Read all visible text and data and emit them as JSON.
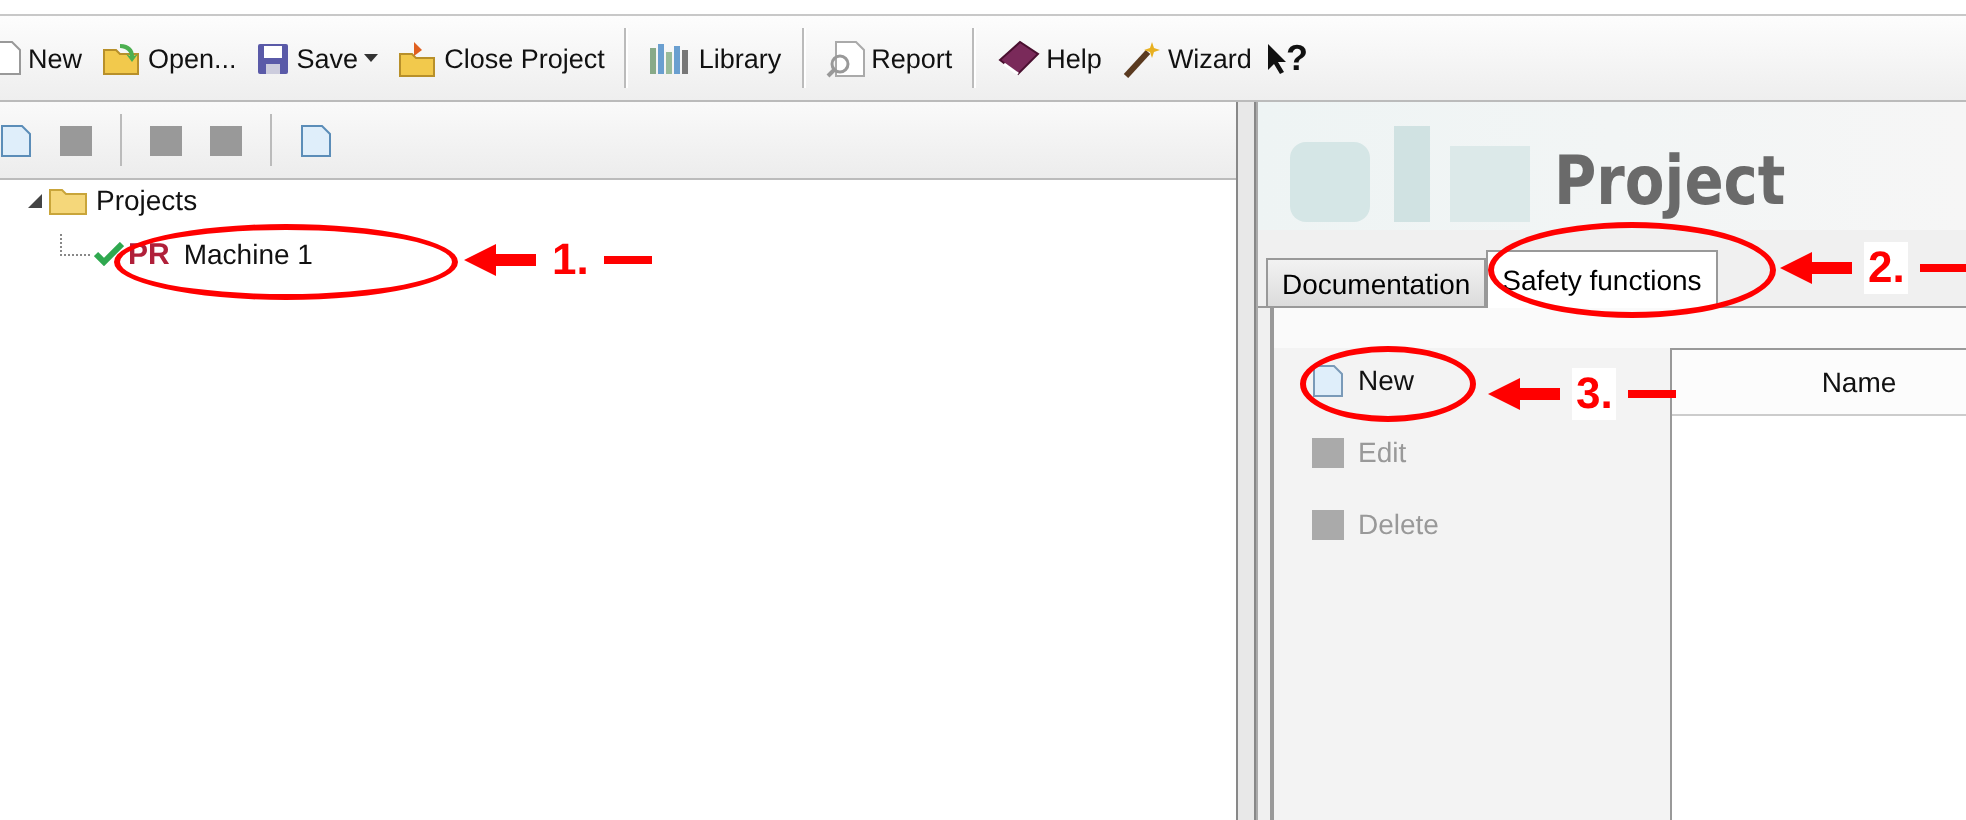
{
  "toolbar": [
    {
      "kind": "button",
      "label": "New"
    },
    {
      "kind": "button",
      "label": "Open..."
    },
    {
      "kind": "dropdown",
      "label": "Save"
    },
    {
      "kind": "button",
      "label": "Close Project"
    },
    {
      "kind": "separator"
    },
    {
      "kind": "button",
      "label": "Library"
    },
    {
      "kind": "separator"
    },
    {
      "kind": "button",
      "label": "Report"
    },
    {
      "kind": "separator"
    },
    {
      "kind": "button",
      "label": "Help"
    },
    {
      "kind": "button",
      "label": "Wizard"
    },
    {
      "kind": "help-cursor",
      "label": "?"
    }
  ],
  "tree_toolbar": [
    {
      "kind": "button",
      "disabled": false
    },
    {
      "kind": "button",
      "disabled": true
    },
    {
      "kind": "separator"
    },
    {
      "kind": "button",
      "disabled": true
    },
    {
      "kind": "button",
      "disabled": true
    },
    {
      "kind": "separator"
    },
    {
      "kind": "button",
      "disabled": false
    }
  ],
  "tree": [
    {
      "label": "Projects",
      "expanded": true,
      "children": [
        {
          "label": "Machine 1",
          "badge": "PR",
          "checked": true
        }
      ]
    }
  ],
  "banner": {
    "title": "Project"
  },
  "tabs": [
    {
      "label": "Documentation",
      "selected": false
    },
    {
      "label": "Safety functions",
      "selected": true
    }
  ],
  "commands": [
    {
      "label": "New",
      "disabled": false
    },
    {
      "label": "Edit",
      "disabled": true
    },
    {
      "label": "Delete",
      "disabled": true
    }
  ],
  "table": {
    "columns": [
      "Name"
    ]
  },
  "annotations": [
    {
      "label": "1."
    },
    {
      "label": "2."
    },
    {
      "label": "3."
    }
  ]
}
